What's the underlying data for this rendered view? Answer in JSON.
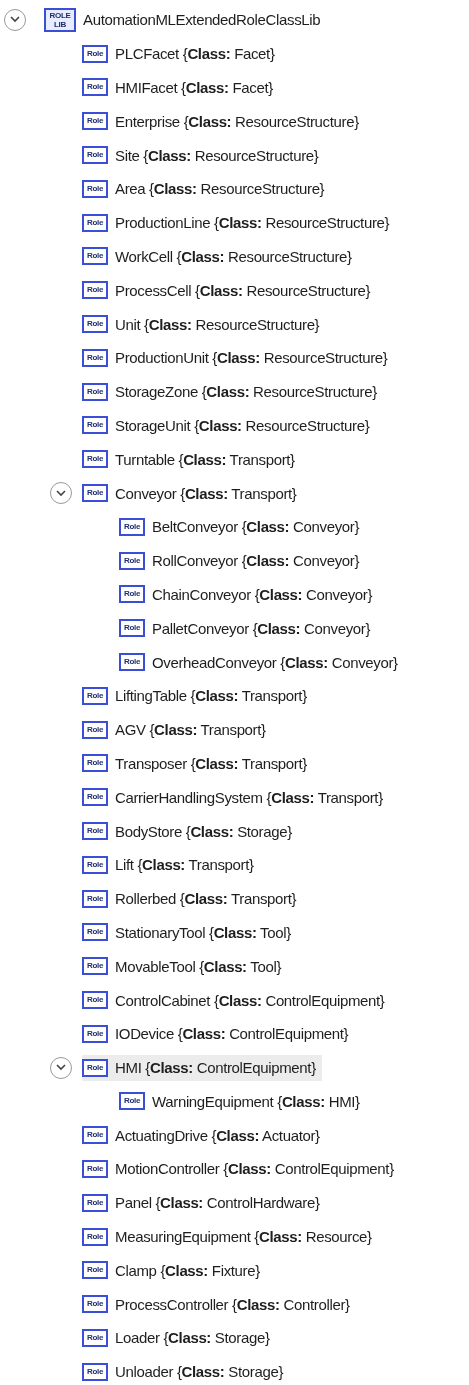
{
  "tree": {
    "label": "AutomationMLExtendedRoleClassLib",
    "badge": "ROLE LIB",
    "kind": "library",
    "expanded": true,
    "selected": false,
    "children": [
      {
        "label": "PLCFacet {**Class:** Facet}",
        "badge": "Role",
        "kind": "role",
        "selected": false
      },
      {
        "label": "HMIFacet {**Class:** Facet}",
        "badge": "Role",
        "kind": "role",
        "selected": false
      },
      {
        "label": "Enterprise {**Class:** ResourceStructure}",
        "badge": "Role",
        "kind": "role",
        "selected": false
      },
      {
        "label": "Site {**Class:** ResourceStructure}",
        "badge": "Role",
        "kind": "role",
        "selected": false
      },
      {
        "label": "Area {**Class:** ResourceStructure}",
        "badge": "Role",
        "kind": "role",
        "selected": false
      },
      {
        "label": "ProductionLine {**Class:** ResourceStructure}",
        "badge": "Role",
        "kind": "role",
        "selected": false
      },
      {
        "label": "WorkCell {**Class:** ResourceStructure}",
        "badge": "Role",
        "kind": "role",
        "selected": false
      },
      {
        "label": "ProcessCell {**Class:** ResourceStructure}",
        "badge": "Role",
        "kind": "role",
        "selected": false
      },
      {
        "label": "Unit {**Class:** ResourceStructure}",
        "badge": "Role",
        "kind": "role",
        "selected": false
      },
      {
        "label": "ProductionUnit {**Class:** ResourceStructure}",
        "badge": "Role",
        "kind": "role",
        "selected": false
      },
      {
        "label": "StorageZone {**Class:** ResourceStructure}",
        "badge": "Role",
        "kind": "role",
        "selected": false
      },
      {
        "label": "StorageUnit {**Class:** ResourceStructure}",
        "badge": "Role",
        "kind": "role",
        "selected": false
      },
      {
        "label": "Turntable {**Class:** Transport}",
        "badge": "Role",
        "kind": "role",
        "selected": false
      },
      {
        "label": "Conveyor {**Class:** Transport}",
        "badge": "Role",
        "kind": "role",
        "selected": false,
        "expanded": true,
        "children": [
          {
            "label": "BeltConveyor {**Class:** Conveyor}",
            "badge": "Role",
            "kind": "role",
            "selected": false
          },
          {
            "label": "RollConveyor {**Class:** Conveyor}",
            "badge": "Role",
            "kind": "role",
            "selected": false
          },
          {
            "label": "ChainConveyor {**Class:** Conveyor}",
            "badge": "Role",
            "kind": "role",
            "selected": false
          },
          {
            "label": "PalletConveyor {**Class:** Conveyor}",
            "badge": "Role",
            "kind": "role",
            "selected": false
          },
          {
            "label": "OverheadConveyor {**Class:** Conveyor}",
            "badge": "Role",
            "kind": "role",
            "selected": false
          }
        ]
      },
      {
        "label": "LiftingTable {**Class:** Transport}",
        "badge": "Role",
        "kind": "role",
        "selected": false
      },
      {
        "label": "AGV {**Class:** Transport}",
        "badge": "Role",
        "kind": "role",
        "selected": false
      },
      {
        "label": "Transposer {**Class:** Transport}",
        "badge": "Role",
        "kind": "role",
        "selected": false
      },
      {
        "label": "CarrierHandlingSystem {**Class:** Transport}",
        "badge": "Role",
        "kind": "role",
        "selected": false
      },
      {
        "label": "BodyStore {**Class:** Storage}",
        "badge": "Role",
        "kind": "role",
        "selected": false
      },
      {
        "label": "Lift {**Class:** Transport}",
        "badge": "Role",
        "kind": "role",
        "selected": false
      },
      {
        "label": "Rollerbed {**Class:** Transport}",
        "badge": "Role",
        "kind": "role",
        "selected": false
      },
      {
        "label": "StationaryTool {**Class:** Tool}",
        "badge": "Role",
        "kind": "role",
        "selected": false
      },
      {
        "label": "MovableTool {**Class:** Tool}",
        "badge": "Role",
        "kind": "role",
        "selected": false
      },
      {
        "label": "ControlCabinet {**Class:** ControlEquipment}",
        "badge": "Role",
        "kind": "role",
        "selected": false
      },
      {
        "label": "IODevice {**Class:** ControlEquipment}",
        "badge": "Role",
        "kind": "role",
        "selected": false
      },
      {
        "label": "HMI {**Class:** ControlEquipment}",
        "badge": "Role",
        "kind": "role",
        "selected": true,
        "expanded": true,
        "children": [
          {
            "label": "WarningEquipment {**Class:** HMI}",
            "badge": "Role",
            "kind": "role",
            "selected": false
          }
        ]
      },
      {
        "label": "ActuatingDrive {**Class:** Actuator}",
        "badge": "Role",
        "kind": "role",
        "selected": false
      },
      {
        "label": "MotionController {**Class:** ControlEquipment}",
        "badge": "Role",
        "kind": "role",
        "selected": false
      },
      {
        "label": "Panel {**Class:** ControlHardware}",
        "badge": "Role",
        "kind": "role",
        "selected": false
      },
      {
        "label": "MeasuringEquipment {**Class:** Resource}",
        "badge": "Role",
        "kind": "role",
        "selected": false
      },
      {
        "label": "Clamp {**Class:** Fixture}",
        "badge": "Role",
        "kind": "role",
        "selected": false
      },
      {
        "label": "ProcessController {**Class:** Controller}",
        "badge": "Role",
        "kind": "role",
        "selected": false
      },
      {
        "label": "Loader {**Class:** Storage}",
        "badge": "Role",
        "kind": "role",
        "selected": false
      },
      {
        "label": "Unloader {**Class:** Storage}",
        "badge": "Role",
        "kind": "role",
        "selected": false
      }
    ]
  }
}
